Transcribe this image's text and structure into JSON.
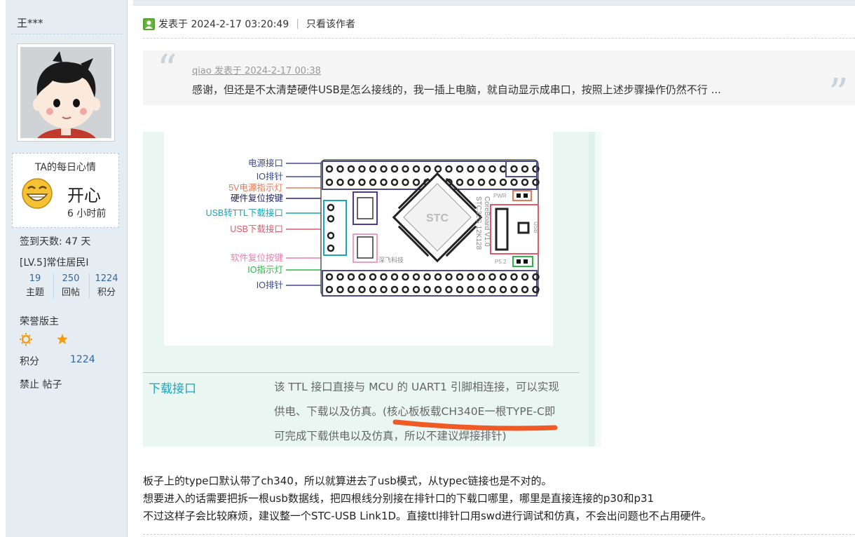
{
  "user": {
    "name": "王***",
    "mood_title": "TA的每日心情",
    "mood": "开心",
    "mood_time": "6 小时前",
    "checkin": "签到天数: 47 天",
    "level": "[LV.5]常住居民I",
    "stats": [
      {
        "value": "19",
        "label": "主题"
      },
      {
        "value": "250",
        "label": "回帖"
      },
      {
        "value": "1224",
        "label": "积分"
      }
    ],
    "honor": "荣誉版主",
    "medal_icons": [
      "sun-icon",
      "moon-icon",
      "star-icon"
    ],
    "points_label": "积分",
    "points_value": "1224",
    "ban_text": "禁止 帖子"
  },
  "post": {
    "posted_at": "发表于 2024-2-17 03:20:49",
    "only_author": "只看该作者",
    "quote": {
      "author_line": "qiao 发表于 2024-2-17 00:38",
      "text": "感谢，但还是不太清楚硬件USB是怎么接线的，我一插上电脑，就自动显示成串口，按照上述步骤操作仍然不行 ..."
    },
    "image": {
      "labels": [
        "电源接口",
        "IO排针",
        "5V电源指示灯",
        "硬件复位按键",
        "USB转TTL下载接口",
        "USB下载接口",
        "软件复位按键",
        "IO指示灯",
        "IO排针"
      ],
      "label_colors": [
        "#3a4a8a",
        "#3a4a8a",
        "#e57a5a",
        "#222266",
        "#18a6b8",
        "#e25a6a",
        "#e67fb0",
        "#2bb54a",
        "#3a4a8a"
      ],
      "board_text": {
        "model": "STC32G 12K128",
        "core": "CoreBoard V1.0",
        "brand": "STC",
        "maker": "深飞科技",
        "pwr": "PWR",
        "p52": "P5.2",
        "usb": "USB"
      },
      "download_title": "下载接口",
      "download_lines": [
        "该 TTL 接口直接与 MCU 的 UART1 引脚相连接，可以实现",
        "供电、下载以及仿真。(核心板板载CH340E一根TYPE-C即",
        "可完成下载供电以及仿真，所以不建议焊接排针)"
      ]
    },
    "body_lines": [
      "板子上的type口默认带了ch340，所以就算进去了usb模式，从typec链接也是不对的。",
      "想要进入的话需要把拆一根usb数据线，把四根线分别接在排针口的下载口哪里，哪里是直接连接的p30和p31",
      "不过这样子会比较麻烦，建议整一个STC-USB Link1D。直接ttl排针口用swd进行调试和仿真，不会出问题也不占用硬件。"
    ]
  }
}
